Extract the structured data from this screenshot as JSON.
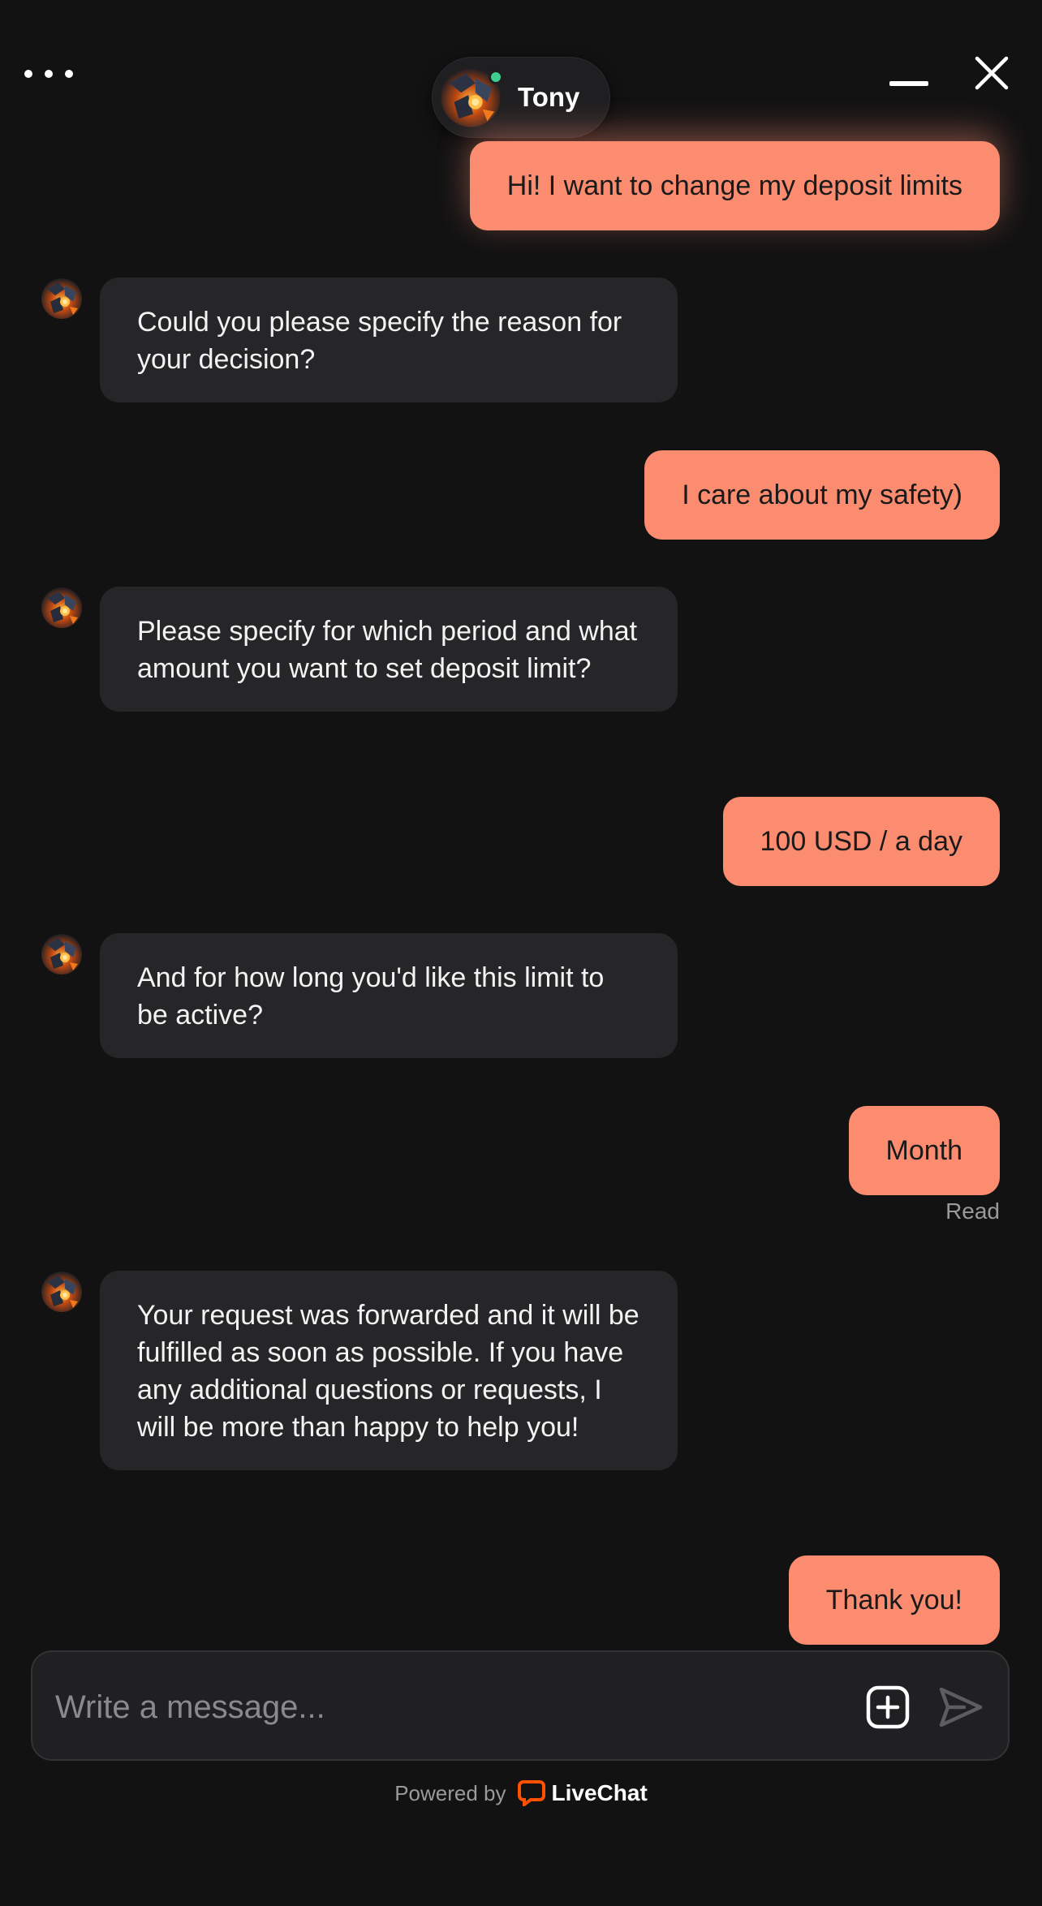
{
  "header": {
    "agent_name": "Tony",
    "status_color": "#3ecf8e",
    "menu_icon": "more-dots-icon",
    "minimize_icon": "minimize-icon",
    "close_icon": "close-icon"
  },
  "messages": [
    {
      "from": "visitor",
      "text": "Hi! I want to change my deposit limits"
    },
    {
      "from": "agent",
      "text": "Could you please specify the reason for your decision?"
    },
    {
      "from": "visitor",
      "text": "I care about my safety)"
    },
    {
      "from": "agent",
      "text": "Please specify for which period and what amount you want to set deposit limit?"
    },
    {
      "from": "visitor",
      "text": "100 USD / a day"
    },
    {
      "from": "agent",
      "text": "And for how long you'd like this limit to be active?"
    },
    {
      "from": "visitor",
      "text": "Month",
      "receipt": "Read"
    },
    {
      "from": "agent",
      "text": "Your request was forwarded and it will be fulfilled as soon as possible. If you have any additional questions or requests, I will be more than happy to help you!"
    },
    {
      "from": "visitor",
      "text": "Thank you!"
    }
  ],
  "composer": {
    "placeholder": "Write a message...",
    "attach_icon": "add-attachment-icon",
    "send_icon": "send-icon"
  },
  "footer": {
    "powered_by": "Powered by",
    "brand": "LiveChat",
    "brand_color": "#ff5100"
  },
  "colors": {
    "background": "#121213",
    "visitor_bubble": "#fb8c70",
    "agent_bubble": "#262628"
  }
}
